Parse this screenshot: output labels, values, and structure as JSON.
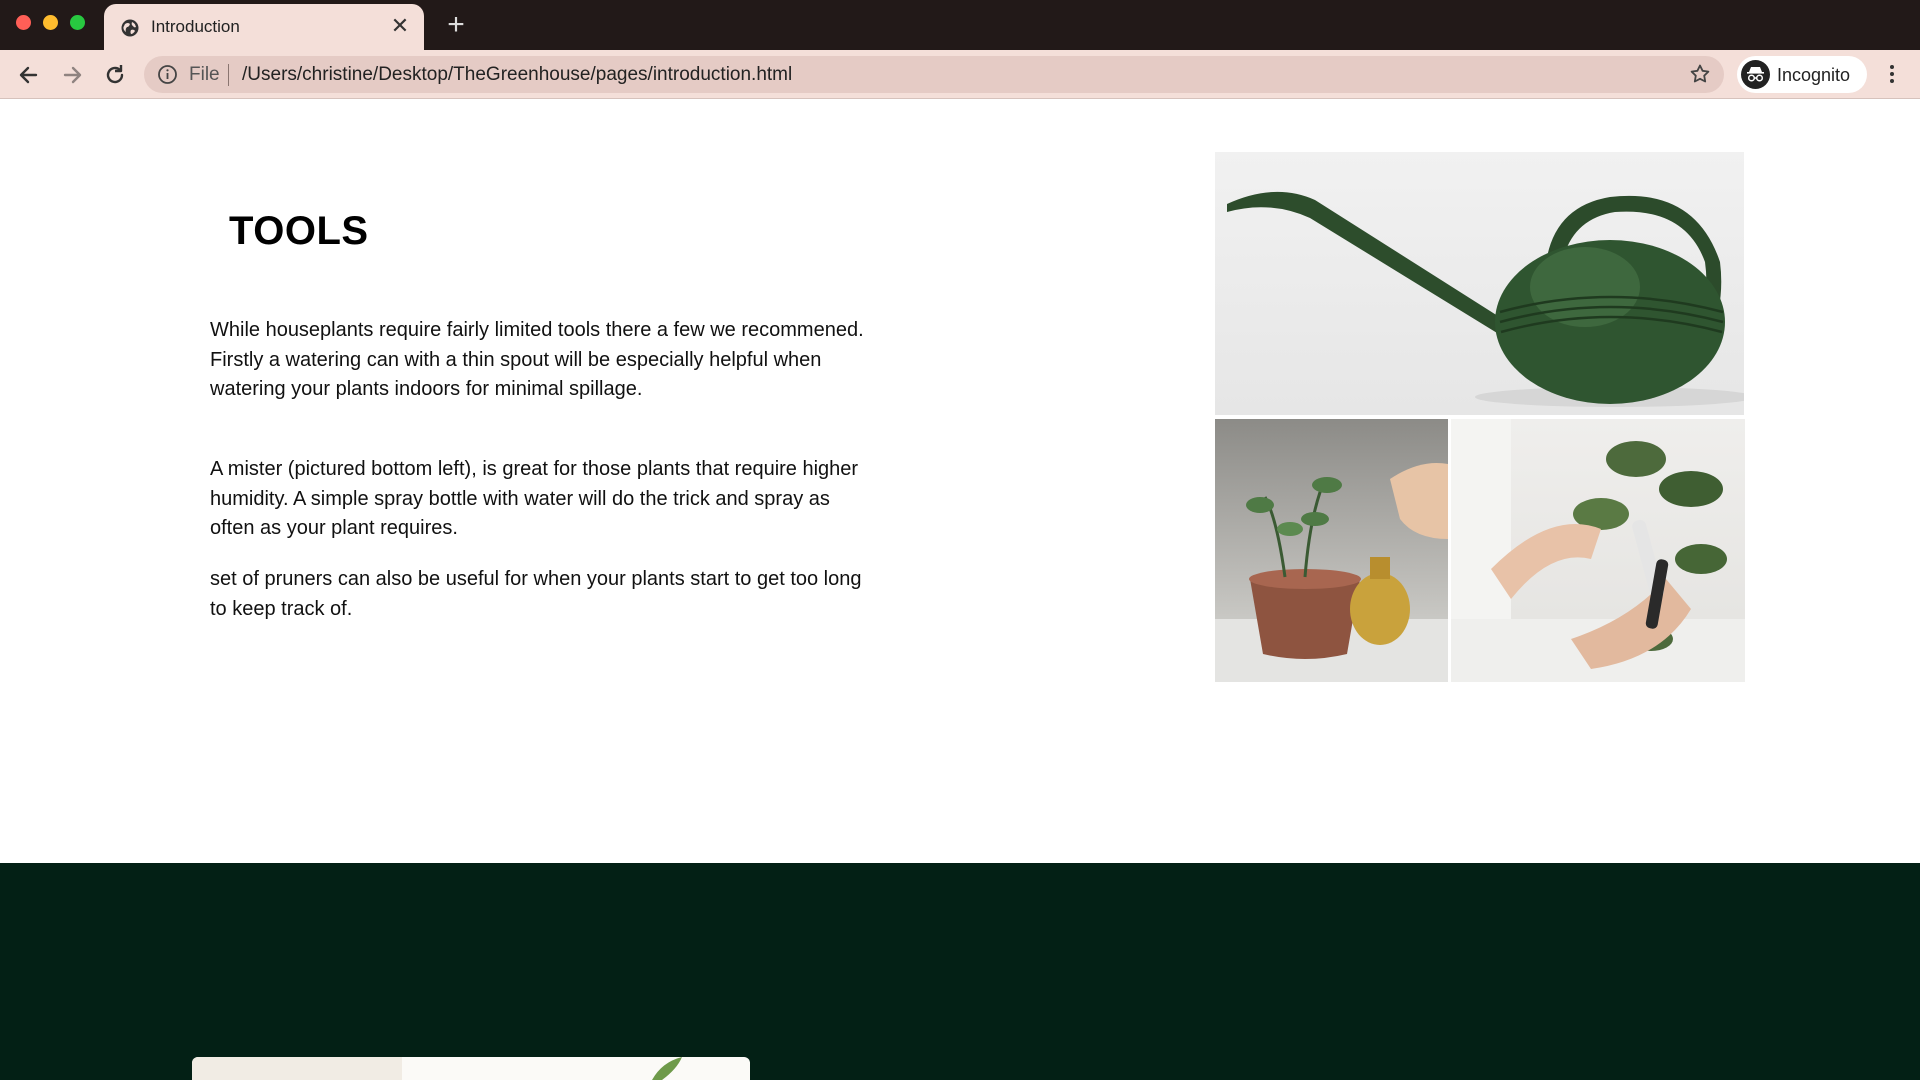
{
  "browser": {
    "tab_title": "Introduction",
    "tab_close": "✕",
    "new_tab": "+",
    "scheme_label": "File",
    "url": "/Users/christine/Desktop/TheGreenhouse/pages/introduction.html",
    "incognito_label": "Incognito",
    "colors": {
      "close": "#ff5f57",
      "minimize": "#febc2e",
      "maximize": "#28c840",
      "tab_bg": "#f4dfd9",
      "titlebar": "#221918"
    }
  },
  "content": {
    "title": "TOOLS",
    "paragraphs": [
      "While houseplants require fairly limited tools there a few we recommened. Firstly a watering can with a thin spout will be especially helpful when watering your plants indoors for minimal spillage.",
      "A mister (pictured bottom left), is great for those plants that require higher humidity. A simple spray bottle with water will do the trick and spray as often as your plant requires.",
      "set of pruners can also be useful for when your plants start to get too long to keep track of."
    ]
  },
  "footer": {
    "color": "#032015"
  }
}
